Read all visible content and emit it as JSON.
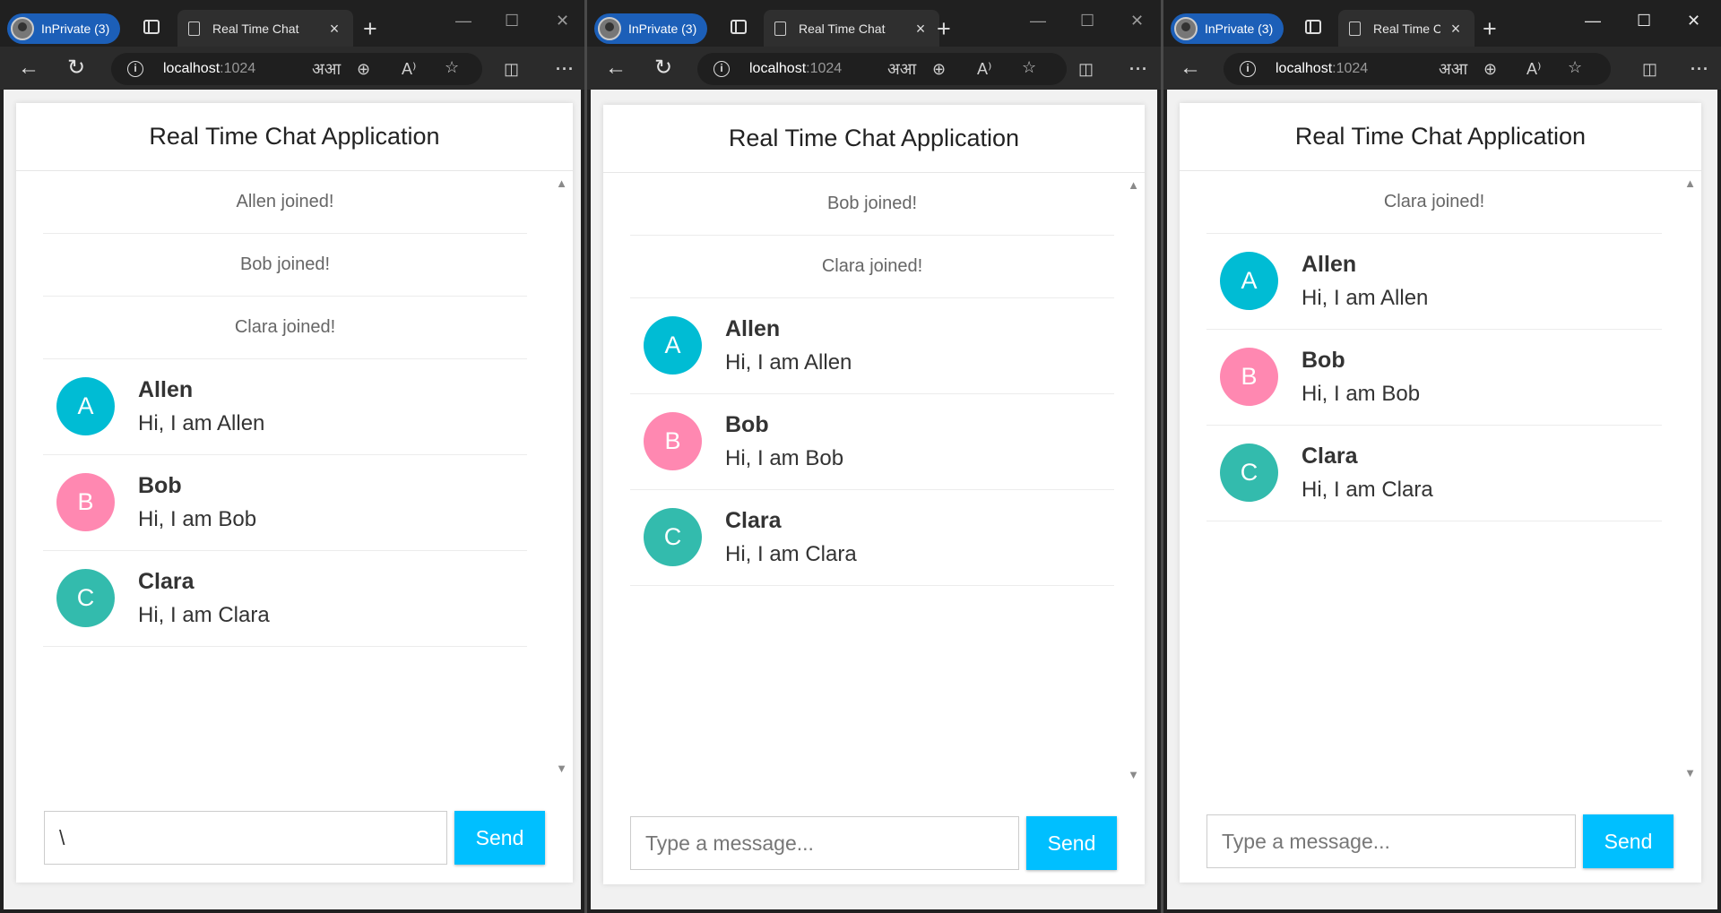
{
  "browser": {
    "inprivate_label": "InPrivate (3)",
    "address_host": "localhost",
    "address_port": ":1024",
    "read_aloud": "A⁾",
    "immersive_reader": "अआ"
  },
  "app": {
    "title": "Real Time Chat Application",
    "send_label": "Send",
    "placeholder": "Type a message..."
  },
  "windows": [
    {
      "tab_title": "Real Time Chat",
      "input_value": "\\",
      "events": [
        "Allen joined!",
        "Bob joined!",
        "Clara joined!"
      ]
    },
    {
      "tab_title": "Real Time Chat",
      "input_value": "",
      "events": [
        "Bob joined!",
        "Clara joined!"
      ]
    },
    {
      "tab_title": "Real Time C",
      "input_value": "",
      "events": [
        "Clara joined!"
      ]
    }
  ],
  "users": [
    {
      "initial": "A",
      "name": "Allen",
      "text": "Hi, I am Allen",
      "color": "#00bcd4"
    },
    {
      "initial": "B",
      "name": "Bob",
      "text": "Hi, I am Bob",
      "color": "#ff88b1"
    },
    {
      "initial": "C",
      "name": "Clara",
      "text": "Hi, I am Clara",
      "color": "#33bbad"
    }
  ],
  "theme": {
    "accent": "#00bfff",
    "inprivate_bg": "#1c5fb8"
  }
}
